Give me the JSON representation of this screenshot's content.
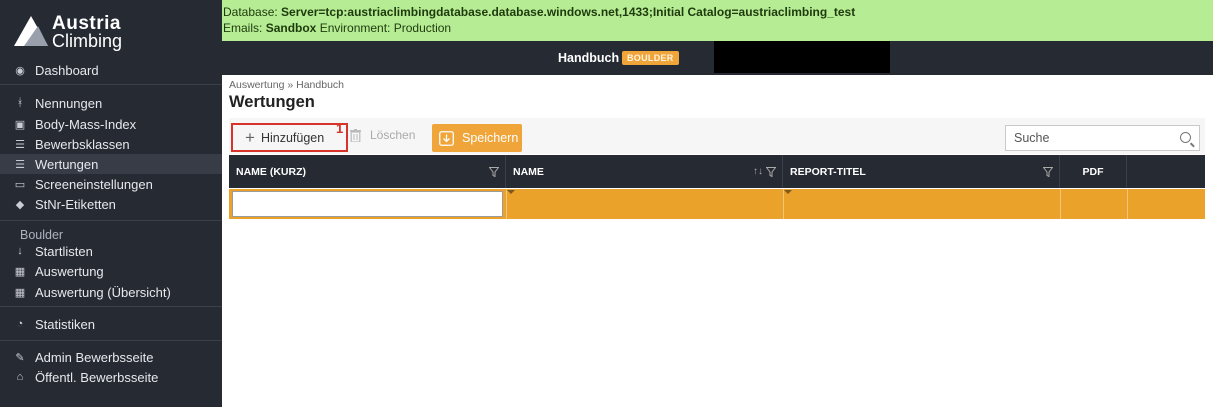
{
  "app": {
    "brand_line1": "Austria",
    "brand_line2": "Climbing"
  },
  "env": {
    "db_label": "Database: ",
    "db_value": "Server=tcp:austriaclimbingdatabase.database.windows.net,1433;Initial Catalog=austriaclimbing_test",
    "emails_label": "Emails: ",
    "emails_value": "Sandbox",
    "env_text": " Environment: Production",
    "bg_color": "#b6ec93"
  },
  "header": {
    "title": "Handbuch",
    "badge": "BOULDER",
    "badge_color": "#f0a53a"
  },
  "sidebar": {
    "items": [
      {
        "label": "Dashboard",
        "icon": "dashboard-icon"
      },
      {
        "label": "Nennungen",
        "icon": "people-icon"
      },
      {
        "label": "Body-Mass-Index",
        "icon": "scale-icon"
      },
      {
        "label": "Bewerbsklassen",
        "icon": "list-icon"
      },
      {
        "label": "Wertungen",
        "icon": "list-icon"
      },
      {
        "label": "Screeneinstellungen",
        "icon": "monitor-icon"
      },
      {
        "label": "StNr-Etiketten",
        "icon": "tag-icon"
      }
    ],
    "section_heading": "Boulder",
    "section_items": [
      {
        "label": "Startlisten",
        "icon": "sort-icon"
      },
      {
        "label": "Auswertung",
        "icon": "scoreboard-icon"
      },
      {
        "label": "Auswertung (Übersicht)",
        "icon": "scoreboard-icon"
      }
    ],
    "stats": {
      "label": "Statistiken",
      "icon": "pie-chart-icon"
    },
    "admin_items": [
      {
        "label": "Admin Bewerbsseite",
        "icon": "edit-icon"
      },
      {
        "label": "Öffentl. Bewerbsseite",
        "icon": "home-icon"
      }
    ]
  },
  "breadcrumb": {
    "text": "Auswertung » Handbuch"
  },
  "page": {
    "title": "Wertungen"
  },
  "toolbar": {
    "add_label": "Hinzufügen",
    "step_number": "1",
    "delete_label": "Löschen",
    "save_label": "Speichern",
    "save_color": "#f0a53a",
    "search_placeholder": "Suche"
  },
  "grid": {
    "columns": [
      "NAME (KURZ)",
      "NAME",
      "REPORT-TITEL",
      "PDF"
    ],
    "row_color": "#eba22b",
    "name_short_value": ""
  }
}
